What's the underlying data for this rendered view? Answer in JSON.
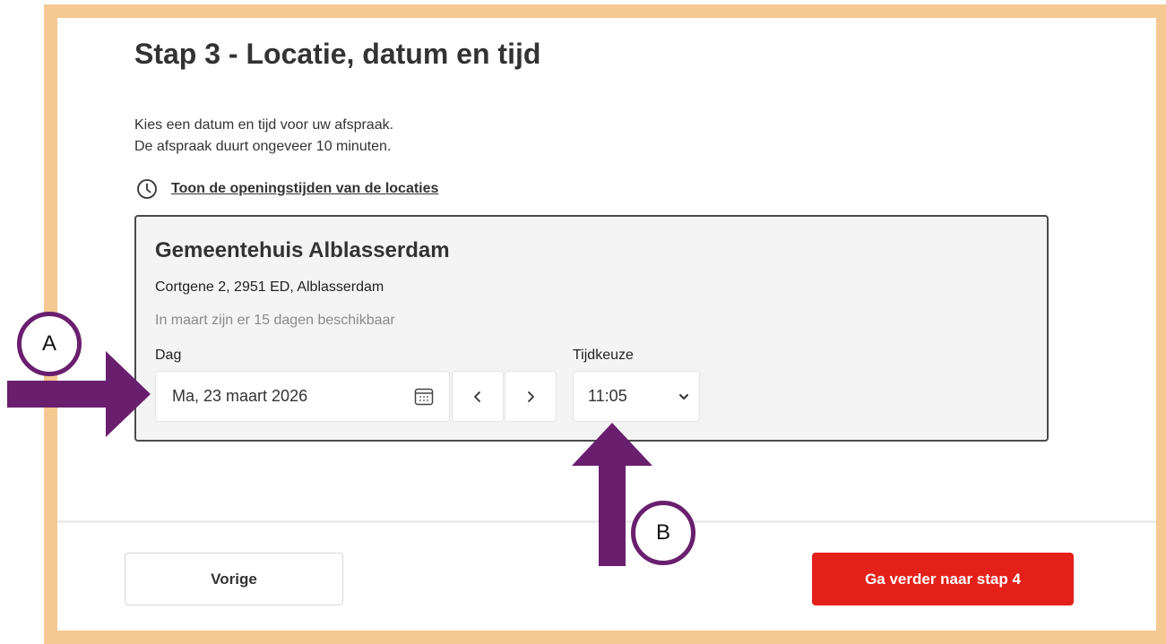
{
  "page": {
    "title": "Stap 3 - Locatie, datum en tijd",
    "intro_line1": "Kies een datum en tijd voor uw afspraak.",
    "intro_line2": "De afspraak duurt ongeveer 10 minuten.",
    "hours_link": "Toon de openingstijden van de locaties"
  },
  "location": {
    "name": "Gemeentehuis Alblasserdam",
    "address": "Cortgene 2, 2951 ED, Alblasserdam",
    "availability": "In maart zijn er 15 dagen beschikbaar"
  },
  "day": {
    "label": "Dag",
    "value": "Ma, 23 maart 2026",
    "prev": "‹",
    "next": "›"
  },
  "time": {
    "label": "Tijdkeuze",
    "value": "11:05"
  },
  "footer": {
    "prev_label": "Vorige",
    "next_label": "Ga verder naar stap 4"
  },
  "annotations": {
    "marker_a": "A",
    "marker_b": "B"
  },
  "colors": {
    "frame": "#f6c892",
    "primary_button": "#e3211a",
    "annotation": "#6a1f6e",
    "card_bg": "#f4f4f4"
  },
  "icons": {
    "hours": "clock-icon",
    "calendar": "calendar-icon",
    "time_dropdown": "chevron-down-icon"
  }
}
